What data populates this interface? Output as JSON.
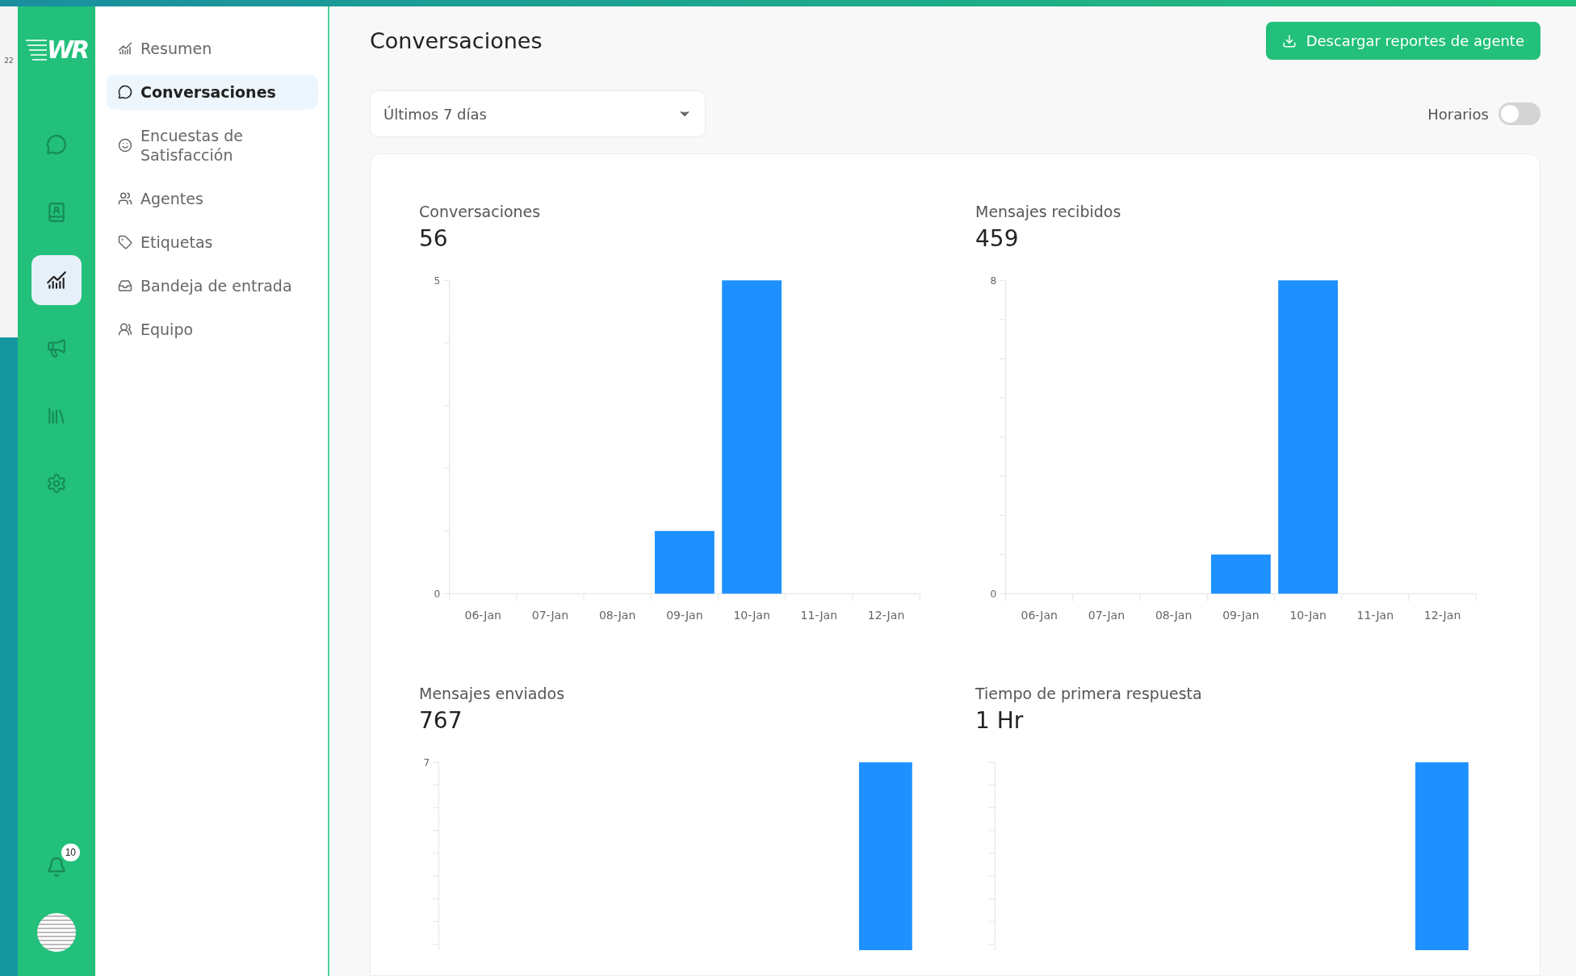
{
  "backdrop": {
    "text": "22"
  },
  "rail": {
    "logo": "WR",
    "items": [
      {
        "selected": false
      },
      {
        "selected": false
      },
      {
        "selected": true
      },
      {
        "selected": false
      },
      {
        "selected": false
      },
      {
        "selected": false
      }
    ],
    "notifications": {
      "count": "10"
    }
  },
  "sidebar": {
    "items": [
      {
        "label": "Resumen",
        "selected": false
      },
      {
        "label": "Conversaciones",
        "selected": true
      },
      {
        "label": "Encuestas de Satisfacción",
        "selected": false
      },
      {
        "label": "Agentes",
        "selected": false
      },
      {
        "label": "Etiquetas",
        "selected": false
      },
      {
        "label": "Bandeja de entrada",
        "selected": false
      },
      {
        "label": "Equipo",
        "selected": false
      }
    ]
  },
  "header": {
    "title": "Conversaciones",
    "download_button": "Descargar reportes de agente"
  },
  "filters": {
    "range_select": {
      "value": "Últimos 7 días"
    },
    "schedule_toggle": {
      "label": "Horarios",
      "on": false
    }
  },
  "metrics": [
    {
      "label": "Conversaciones",
      "value": "56",
      "chart_data": {
        "type": "bar",
        "categories": [
          "06-Jan",
          "07-Jan",
          "08-Jan",
          "09-Jan",
          "10-Jan",
          "11-Jan",
          "12-Jan"
        ],
        "series": [
          {
            "color": "#1e90ff",
            "values": [
              0,
              0,
              0,
              1,
              5,
              0,
              0
            ]
          }
        ],
        "ylim": [
          0,
          5
        ],
        "yticks": [
          0,
          5
        ]
      }
    },
    {
      "label": "Mensajes recibidos",
      "value": "459",
      "chart_data": {
        "type": "bar",
        "categories": [
          "06-Jan",
          "07-Jan",
          "08-Jan",
          "09-Jan",
          "10-Jan",
          "11-Jan",
          "12-Jan"
        ],
        "series": [
          {
            "color": "#1e90ff",
            "values": [
              0,
              0,
              0,
              1,
              8,
              0,
              0
            ]
          }
        ],
        "ylim": [
          0,
          8
        ],
        "yticks": [
          0,
          8
        ]
      }
    }
  ],
  "metrics_cut": [
    {
      "label": "Mensajes enviados",
      "value": "767",
      "top_tick": "7"
    },
    {
      "label": "Tiempo de primera respuesta",
      "value": "1 Hr"
    }
  ]
}
